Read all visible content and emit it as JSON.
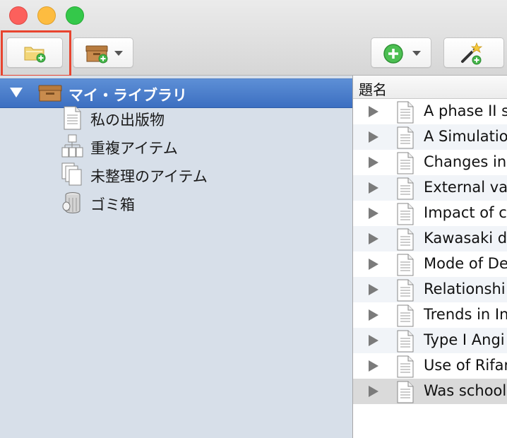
{
  "sidebar": {
    "library_label": "マイ・ライブラリ",
    "items": [
      {
        "label": "私の出版物"
      },
      {
        "label": "重複アイテム"
      },
      {
        "label": "未整理のアイテム"
      },
      {
        "label": "ゴミ箱"
      }
    ]
  },
  "list": {
    "column_title": "題名",
    "rows": [
      {
        "title": "A phase II s"
      },
      {
        "title": "A Simulatio"
      },
      {
        "title": "Changes in"
      },
      {
        "title": "External va"
      },
      {
        "title": "Impact of c"
      },
      {
        "title": "Kawasaki d"
      },
      {
        "title": "Mode of De"
      },
      {
        "title": "Relationshi"
      },
      {
        "title": "Trends in In"
      },
      {
        "title": "Type I Angi"
      },
      {
        "title": "Use of Rifar"
      },
      {
        "title": "Was school"
      }
    ]
  },
  "colors": {
    "selection_blue": "#4a7fcf",
    "sidebar_bg": "#d7dfe9",
    "highlight_red": "#e8442f"
  }
}
